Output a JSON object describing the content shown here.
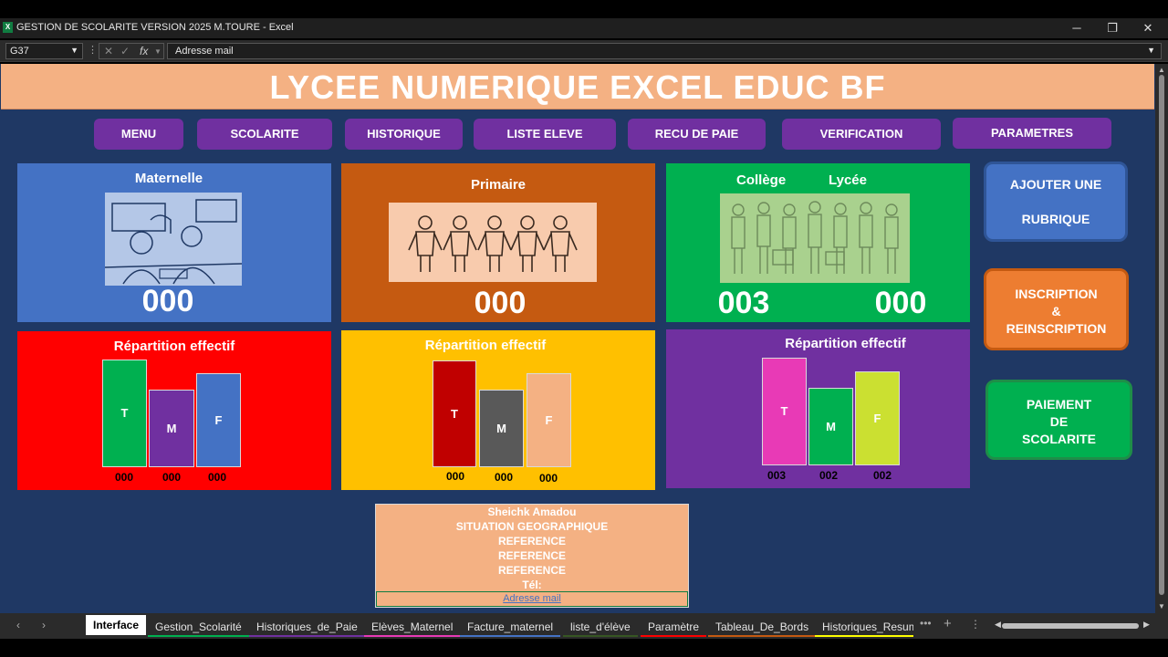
{
  "window": {
    "title": "GESTION DE SCOLARITE VERSION 2025 M.TOURE  -  Excel",
    "app_icon": "X"
  },
  "formula_bar": {
    "cell_ref": "G37",
    "fx": "fx",
    "content": "Adresse mail"
  },
  "banner": "LYCEE NUMERIQUE EXCEL EDUC BF",
  "nav": [
    "MENU",
    "SCOLARITE",
    "HISTORIQUE",
    "LISTE ELEVE",
    "RECU DE PAIE",
    "VERIFICATION",
    "PARAMETRES"
  ],
  "cards": {
    "maternelle": {
      "title": "Maternelle",
      "count": "000",
      "color": "#4472c4"
    },
    "primaire": {
      "title": "Primaire",
      "count": "000",
      "color": "#c55a11"
    },
    "college_lycee": {
      "title_college": "Collège",
      "title_lycee": "Lycée",
      "count_college": "003",
      "count_lycee": "000",
      "color": "#00b050"
    }
  },
  "repartition": [
    {
      "title": "Répartition effectif",
      "bg": "#ff0000",
      "bars": [
        {
          "label": "T",
          "value": "000",
          "color": "#00b050"
        },
        {
          "label": "M",
          "value": "000",
          "color": "#7030a0"
        },
        {
          "label": "F",
          "value": "000",
          "color": "#4472c4"
        }
      ]
    },
    {
      "title": "Répartition effectif",
      "bg": "#ffc000",
      "bars": [
        {
          "label": "T",
          "value": "000",
          "color": "#c00000"
        },
        {
          "label": "M",
          "value": "000",
          "color": "#595959"
        },
        {
          "label": "F",
          "value": "000",
          "color": "#f4b183"
        }
      ]
    },
    {
      "title": "Répartition effectif",
      "bg": "#7030a0",
      "bars": [
        {
          "label": "T",
          "value": "003",
          "color": "#e83ab6"
        },
        {
          "label": "M",
          "value": "002",
          "color": "#00b050"
        },
        {
          "label": "F",
          "value": "002",
          "color": "#cbe031"
        }
      ]
    }
  ],
  "side_buttons": {
    "ajouter": {
      "line1": "AJOUTER UNE",
      "line2": "RUBRIQUE"
    },
    "inscription": {
      "line1": "INSCRIPTION",
      "line2": "&",
      "line3": "REINSCRIPTION"
    },
    "paiement": {
      "line1": "PAIEMENT",
      "line2": "DE",
      "line3": "SCOLARITE"
    }
  },
  "contact": {
    "name": "Sheichk Amadou",
    "location": "SITUATION GEOGRAPHIQUE",
    "ref1": "REFERENCE",
    "ref2": "REFERENCE",
    "ref3": "REFERENCE",
    "tel": "Tél:",
    "mail": "Adresse mail"
  },
  "tabs": [
    {
      "label": "Interface",
      "color": "#ffffff",
      "active": true
    },
    {
      "label": "Gestion_Scolarité",
      "color": "#00b050"
    },
    {
      "label": "Historiques_de_Paie",
      "color": "#7030a0"
    },
    {
      "label": "Elèves_Maternel",
      "color": "#e83ab6"
    },
    {
      "label": "Facture_maternel",
      "color": "#4472c4"
    },
    {
      "label": "liste_d'élève",
      "color": "#375623"
    },
    {
      "label": "Paramètre",
      "color": "#ff0000"
    },
    {
      "label": "Tableau_De_Bords",
      "color": "#c55a11"
    },
    {
      "label": "Historiques_Resum",
      "color": "#ffff00"
    }
  ]
}
